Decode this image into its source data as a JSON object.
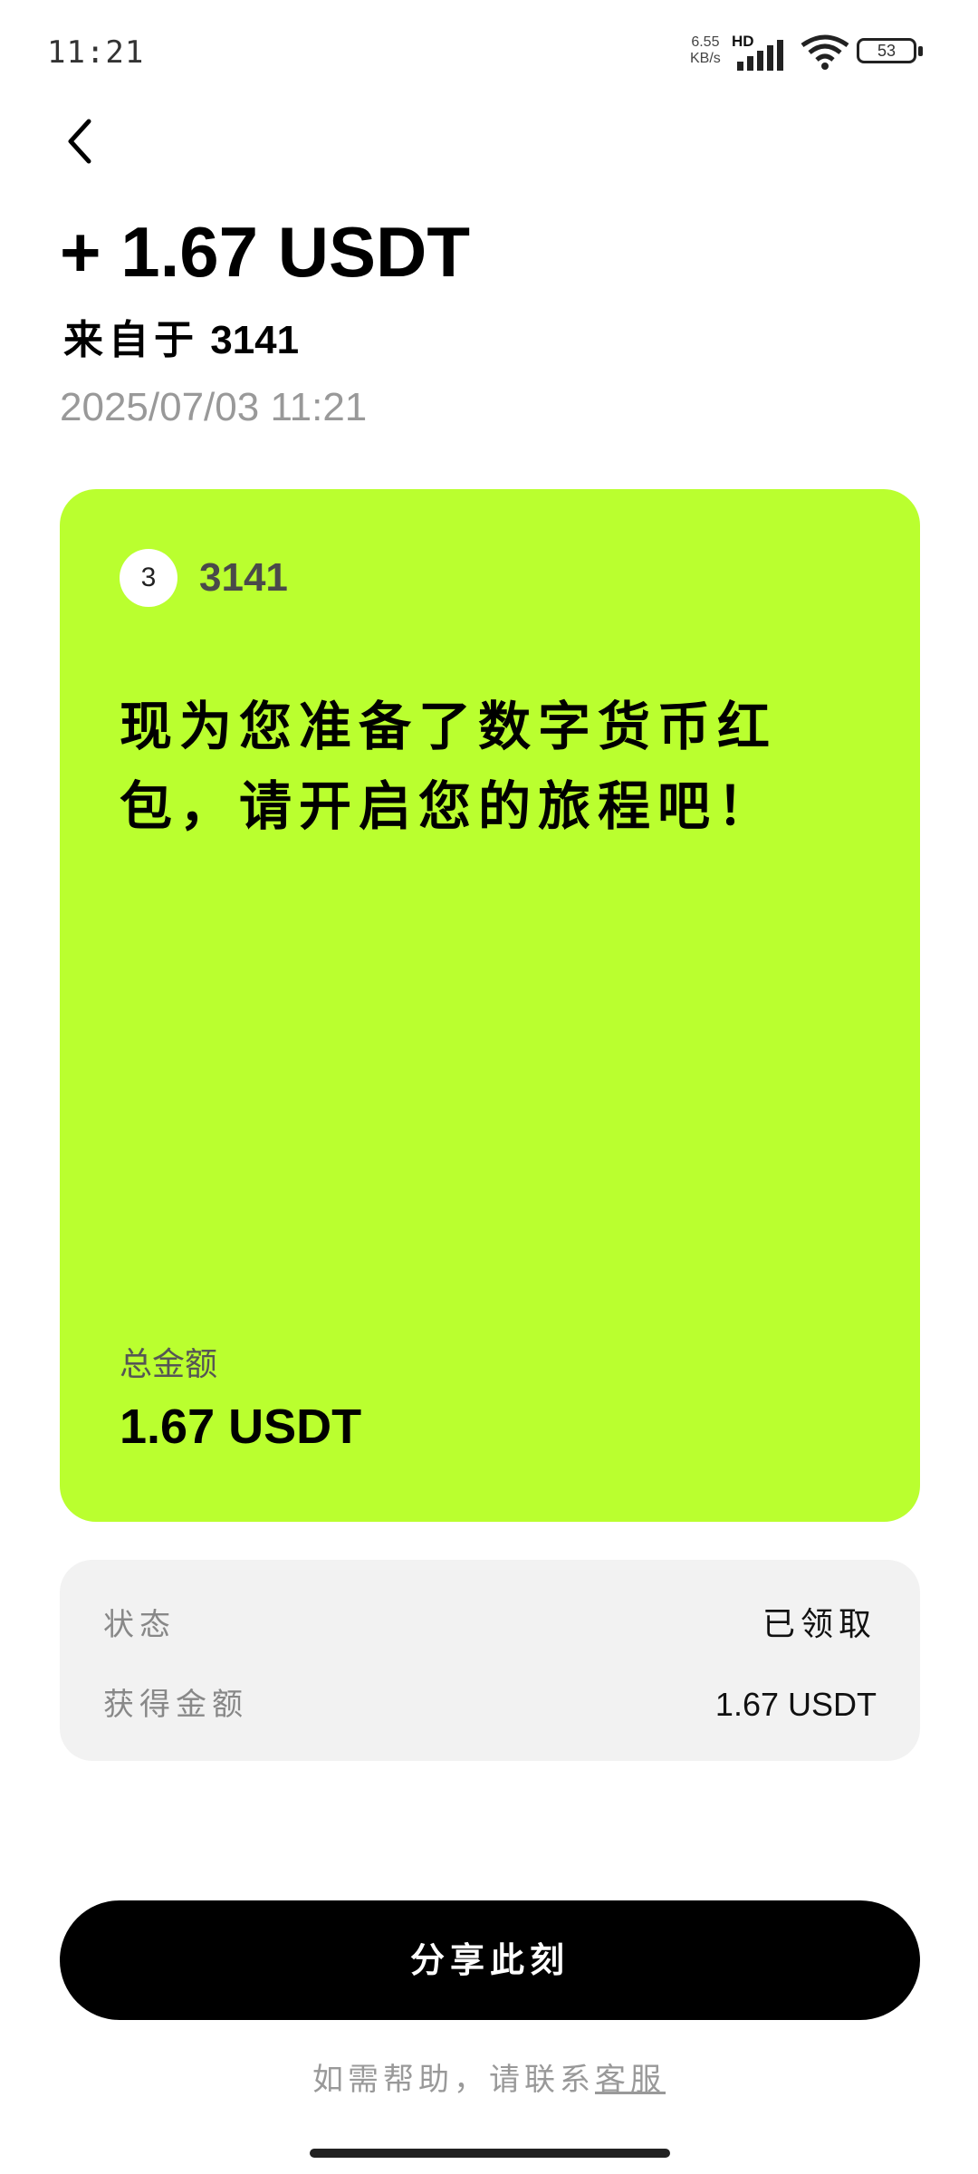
{
  "status_bar": {
    "time": "11:21",
    "net_speed_value": "6.55",
    "net_speed_unit": "KB/s",
    "network_label": "HD",
    "battery_level": "53",
    "icons": [
      "signal-icon",
      "wifi-icon",
      "battery-icon"
    ]
  },
  "header": {
    "back_icon": "chevron-left-icon",
    "amount": "+ 1.67 USDT",
    "sender_prefix": "来自于",
    "sender_name": "3141",
    "timestamp": "2025/07/03 11:21"
  },
  "card": {
    "background_color": "#baff2f",
    "avatar_initial": "3",
    "sender_name": "3141",
    "message": "现为您准备了数字货币红包，请开启您的旅程吧！",
    "total_label": "总金额",
    "total_value": "1.67 USDT"
  },
  "details": {
    "rows": [
      {
        "label": "状态",
        "value": "已领取"
      },
      {
        "label": "获得金额",
        "value": "1.67 USDT"
      }
    ]
  },
  "share_button": {
    "label": "分享此刻"
  },
  "help": {
    "prefix": "如需帮助，请联系",
    "link_label": "客服"
  }
}
